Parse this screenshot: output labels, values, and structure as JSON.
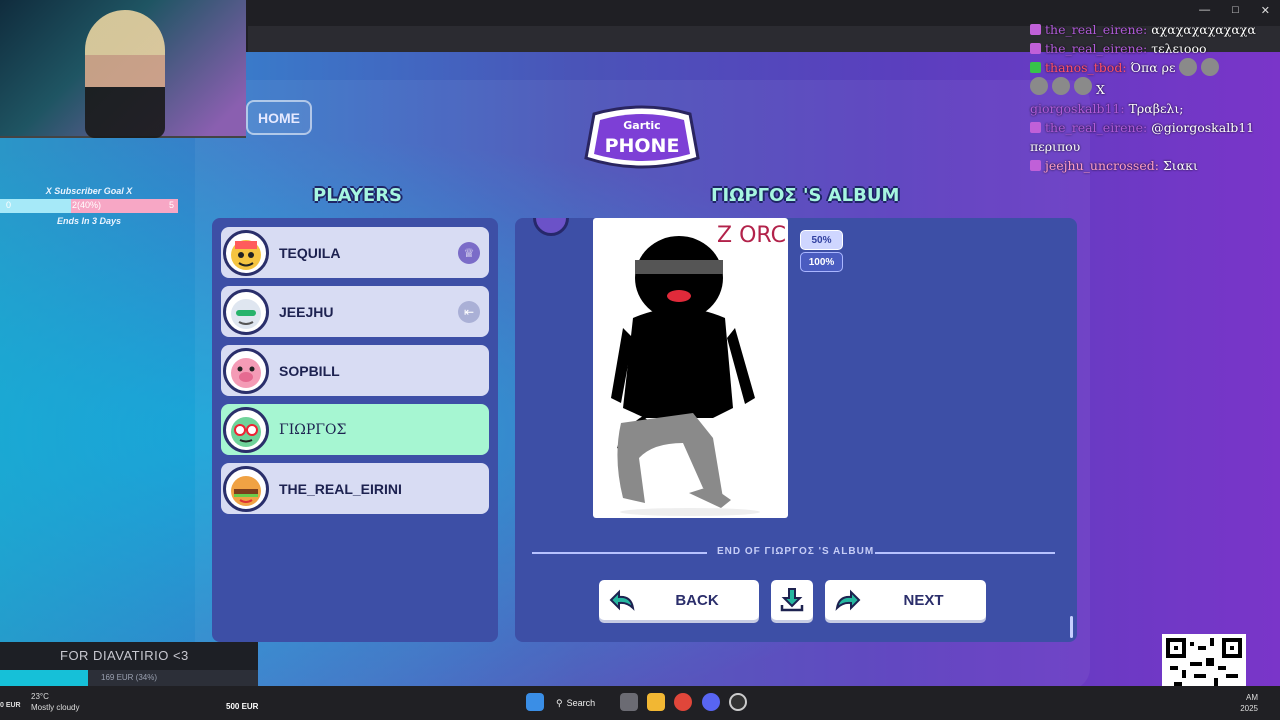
{
  "game": {
    "home_label": "HOME",
    "logo_top": "Gartic",
    "logo_bottom": "PHONE",
    "players_title": "PLAYERS",
    "album_title": "ΓΙΩΡΓΟΣ 'S ALBUM",
    "players": [
      {
        "name": "TEQUILA",
        "badge": "crown-icon"
      },
      {
        "name": "JEEJHU",
        "badge": "exit-icon"
      },
      {
        "name": "SOPBILL",
        "badge": ""
      },
      {
        "name": "ΓΙΩΡΓΟΣ",
        "badge": ""
      },
      {
        "name": "THE_REAL_EIRINI",
        "badge": ""
      }
    ],
    "drawing_text": "Z ORC",
    "zoom_50": "50%",
    "zoom_100": "100%",
    "end_text": "END OF ΓΙΩΡΓΟΣ 'S ALBUM",
    "back_label": "BACK",
    "next_label": "NEXT"
  },
  "stream": {
    "sub_goal_title": "X Subscriber Goal X",
    "goal_start": "0",
    "goal_progress": "2(40%)",
    "goal_end": "5",
    "goal_fraction": 0.4,
    "goal_ends": "Ends In 3 Days",
    "donation_message": "FOR DIAVATIRIO <3",
    "donation_amount": "169 EUR (34%)",
    "donation_fraction": 0.34
  },
  "chat": [
    {
      "user": "the_real_eirene:",
      "msg": "αχαχαχαχαχαχα"
    },
    {
      "user": "the_real_eirene:",
      "msg": "τελειοοο"
    },
    {
      "user": "thanos_tbod:",
      "msg": "Όπα ρε",
      "red": true
    },
    {
      "user": "",
      "msg": "X"
    },
    {
      "user": "giorgoskalb11:",
      "msg": "Τραβελι;"
    },
    {
      "user": "the_real_eirene:",
      "msg": "@giorgoskalb11 περιπου"
    },
    {
      "user": "jeejhu_uncrossed:",
      "msg": "Σιακι",
      "pink": true
    }
  ],
  "taskbar": {
    "temp": "23°C",
    "weather": "Mostly cloudy",
    "eur_left": "0 EUR",
    "eur": "500 EUR",
    "search": "Search",
    "time": "AM",
    "date": "2025"
  }
}
